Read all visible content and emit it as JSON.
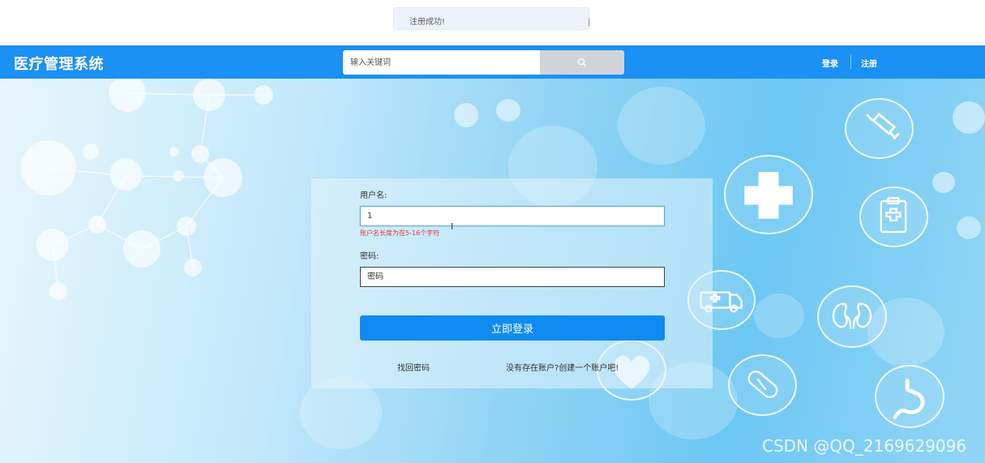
{
  "toast": {
    "message": "注册成功!"
  },
  "header": {
    "app_title": "医疗管理系统",
    "search": {
      "placeholder": "输入关键词",
      "value": ""
    },
    "nav": {
      "login": "登录",
      "register": "注册"
    }
  },
  "login_form": {
    "username_label": "用户名:",
    "username_value": "1",
    "username_error": "账户名长度为在5-16个字符",
    "password_label": "密码:",
    "password_placeholder": "密码",
    "submit_label": "立即登录",
    "forgot_link": "找回密码",
    "register_link": "没有存在账户?创建一个账户吧!"
  },
  "decor_icons": [
    "syringe-icon",
    "medical-cross-icon",
    "clipboard-icon",
    "ambulance-icon",
    "kidneys-icon",
    "heart-icon",
    "pill-icon",
    "stomach-icon"
  ],
  "watermark": "CSDN @QQ_2169629096",
  "colors": {
    "header": "#1b90f5",
    "button": "#0f8bf2",
    "error": "#e53935"
  }
}
